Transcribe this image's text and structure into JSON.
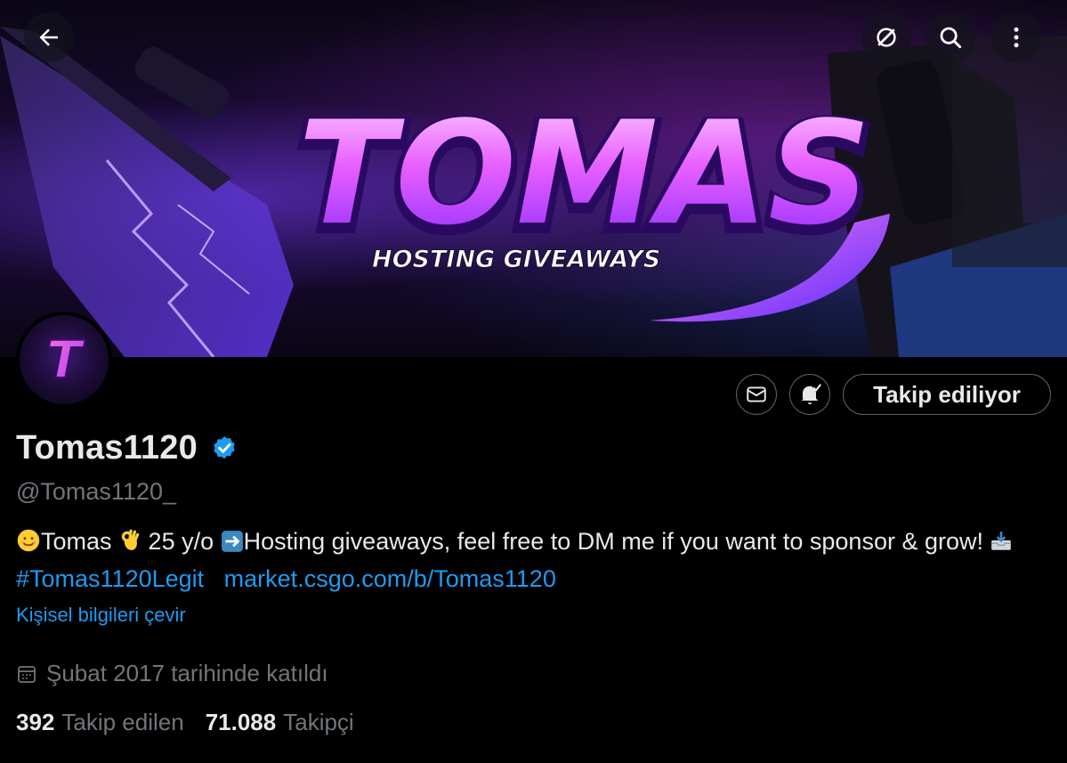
{
  "banner": {
    "title": "TOMAS",
    "subtitle": "HOSTING GIVEAWAYS"
  },
  "topbar": {
    "back_icon": "arrow-left-icon",
    "grok_icon": "grok-icon",
    "search_icon": "search-icon",
    "more_icon": "more-vertical-icon"
  },
  "avatar": {
    "letter": "T"
  },
  "actions": {
    "message_icon": "envelope-icon",
    "notify_icon": "bell-check-icon",
    "follow_label": "Takip ediliyor"
  },
  "profile": {
    "display_name": "Tomas1120",
    "handle": "@Tomas1120_",
    "bio": {
      "part1": "Tomas",
      "part2": " 25 y/o  ",
      "part3": "Hosting giveaways, feel free to DM me if you want to sponsor & grow! ",
      "hashtag": "#Tomas1120Legit",
      "link": "market.csgo.com/b/Tomas1120"
    },
    "translate_label": "Kişisel bilgileri çevir",
    "joined": "Şubat 2017 tarihinde katıldı"
  },
  "stats": {
    "following_count": "392",
    "following_label": "Takip edilen",
    "followers_count": "71.088",
    "followers_label": "Takipçi"
  },
  "colors": {
    "accent": "#1d9bf0",
    "muted": "#71767b",
    "border": "#536471",
    "text": "#e7e9ea"
  }
}
